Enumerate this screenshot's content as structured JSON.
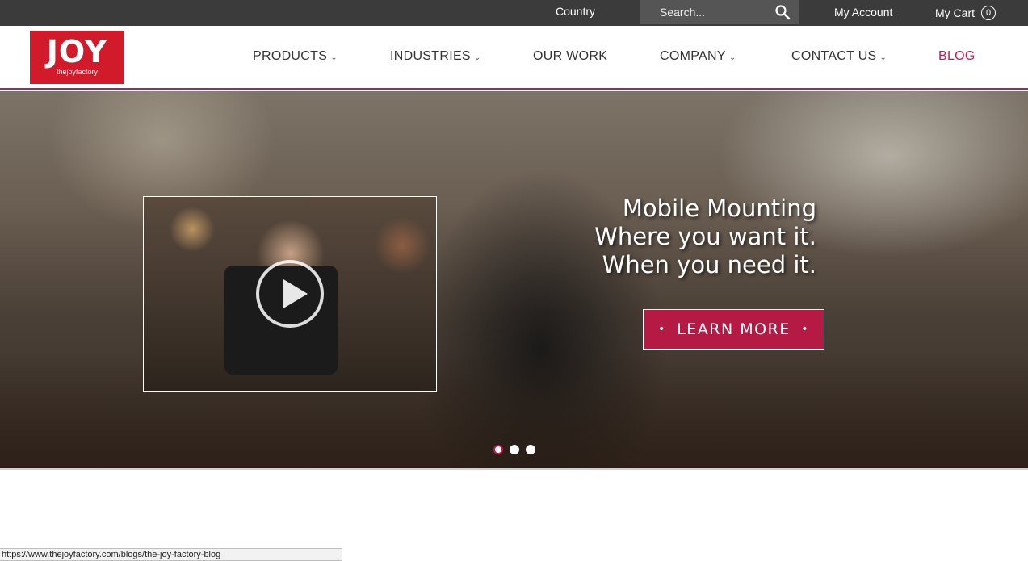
{
  "topbar": {
    "country_label": "Country",
    "search_placeholder": "Search...",
    "account_label": "My Account",
    "cart_label": "My Cart",
    "cart_count": "0"
  },
  "logo": {
    "main": "JOY",
    "sub": "thejoyfactory"
  },
  "nav": {
    "items": [
      {
        "label": "PRODUCTS",
        "has_dropdown": true
      },
      {
        "label": "INDUSTRIES",
        "has_dropdown": true
      },
      {
        "label": "OUR WORK",
        "has_dropdown": false
      },
      {
        "label": "COMPANY",
        "has_dropdown": true
      },
      {
        "label": "CONTACT US",
        "has_dropdown": true
      },
      {
        "label": "BLOG",
        "has_dropdown": false
      }
    ],
    "dropdown_glyph": "⌄"
  },
  "hero": {
    "line1": "Mobile Mounting",
    "line2": "Where you want it.",
    "line3": "When you need it.",
    "cta_label": "LEARN MORE",
    "cta_bullet": "•",
    "slides": 3,
    "active_slide": 1
  },
  "statusbar": {
    "url": "https://www.thejoyfactory.com/blogs/the-joy-factory-blog"
  },
  "colors": {
    "accent": "#c8174c",
    "logo_red": "#d11a2a",
    "topbar_bg": "#3b3b3b",
    "cta_bg": "#b51a45"
  },
  "icons": [
    "search-icon",
    "play-icon",
    "chevron-down-icon"
  ]
}
